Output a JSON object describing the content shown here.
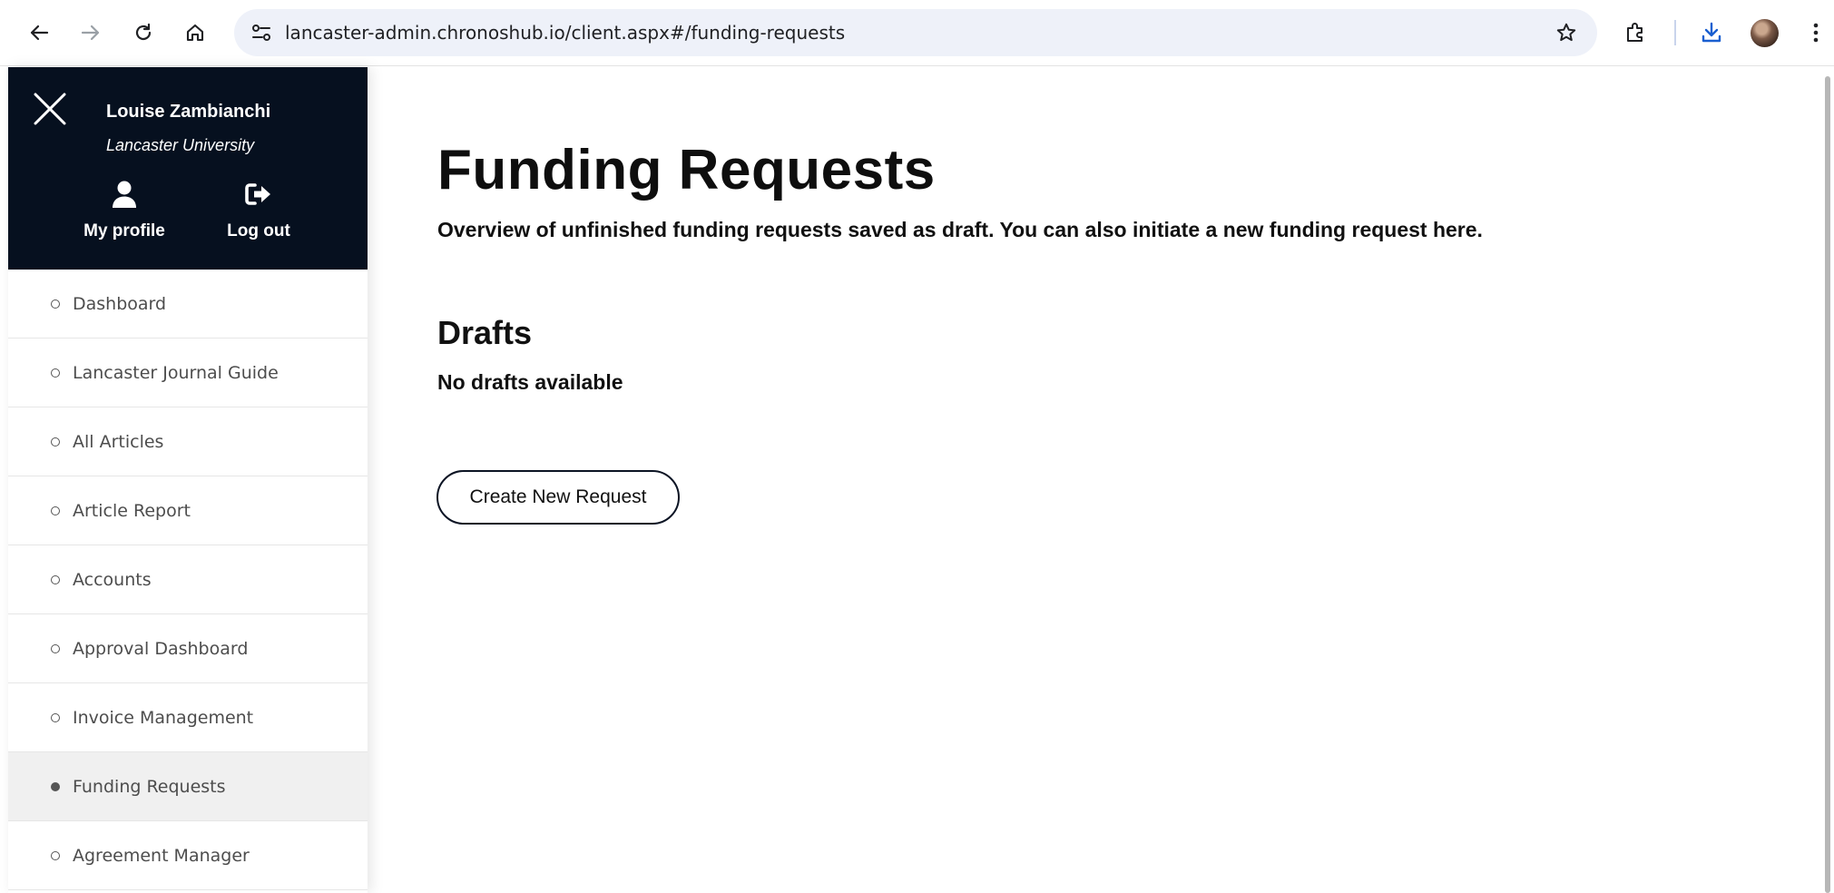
{
  "browser": {
    "url": "lancaster-admin.chronoshub.io/client.aspx#/funding-requests",
    "icons": [
      "back-arrow-icon",
      "forward-arrow-icon",
      "reload-icon",
      "home-icon",
      "site-settings-icon",
      "bookmark-star-icon",
      "extensions-icon",
      "download-icon",
      "profile-avatar",
      "more-menu-icon"
    ]
  },
  "sidebar": {
    "user_name": "Louise Zambianchi",
    "organization": "Lancaster University",
    "profile_label": "My profile",
    "logout_label": "Log out",
    "items": [
      {
        "label": "Dashboard"
      },
      {
        "label": "Lancaster Journal Guide"
      },
      {
        "label": "All Articles"
      },
      {
        "label": "Article Report"
      },
      {
        "label": "Accounts"
      },
      {
        "label": "Approval Dashboard"
      },
      {
        "label": "Invoice Management"
      },
      {
        "label": "Funding Requests"
      },
      {
        "label": "Agreement Manager"
      }
    ],
    "active_item": "Funding Requests",
    "panel_color": "#06101f"
  },
  "main": {
    "title": "Funding Requests",
    "subtitle": "Overview of unfinished funding requests saved as draft. You can also initiate a new funding request here.",
    "drafts_heading": "Drafts",
    "drafts_empty": "No drafts available",
    "create_button": "Create New Request"
  }
}
